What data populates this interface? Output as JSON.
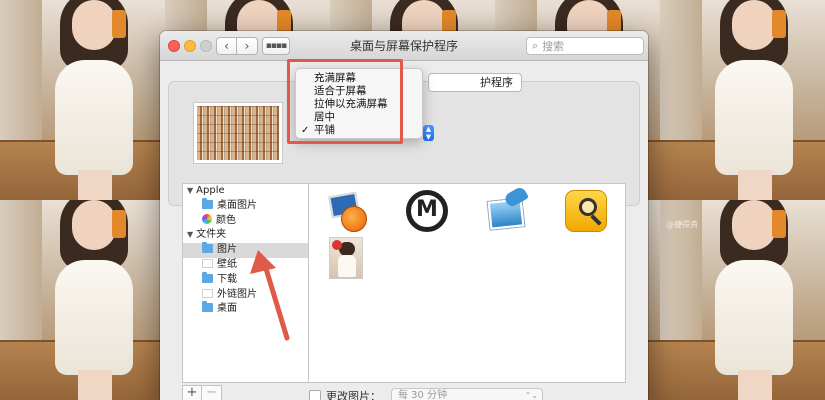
{
  "window": {
    "title": "桌面与屏幕保护程序",
    "search_placeholder": "搜索",
    "tab_partial": "护程序"
  },
  "fit_menu": {
    "items": [
      {
        "label": "充满屏幕",
        "checked": false
      },
      {
        "label": "适合于屏幕",
        "checked": false
      },
      {
        "label": "拉伸以充满屏幕",
        "checked": false
      },
      {
        "label": "居中",
        "checked": false
      },
      {
        "label": "平铺",
        "checked": true
      }
    ],
    "check_glyph": "✓"
  },
  "sidebar": {
    "groups": [
      {
        "label": "Apple",
        "items": [
          {
            "label": "桌面图片",
            "icon": "folder-icon"
          },
          {
            "label": "颜色",
            "icon": "color-wheel-icon"
          }
        ]
      },
      {
        "label": "文件夹",
        "items": [
          {
            "label": "图片",
            "icon": "folder-icon",
            "selected": true
          },
          {
            "label": "壁纸",
            "icon": "folder-icon"
          },
          {
            "label": "下载",
            "icon": "folder-icon"
          },
          {
            "label": "外链图片",
            "icon": "folder-icon"
          },
          {
            "label": "桌面",
            "icon": "folder-icon"
          }
        ]
      }
    ],
    "add_label": "+",
    "remove_label": "−"
  },
  "images": [
    {
      "icon": "app-orange-ball-icon"
    },
    {
      "icon": "m-logo-icon"
    },
    {
      "icon": "preview-photo-icon"
    },
    {
      "icon": "magnifier-app-icon"
    },
    {
      "icon": "photo-thumbnail"
    }
  ],
  "change_picture": {
    "label": "更改图片：",
    "interval": "每 30 分钟"
  },
  "watermark": "@捷得资",
  "colors": {
    "annotation_red": "#e05a4c",
    "selection_blue": "#1d6ff2"
  }
}
